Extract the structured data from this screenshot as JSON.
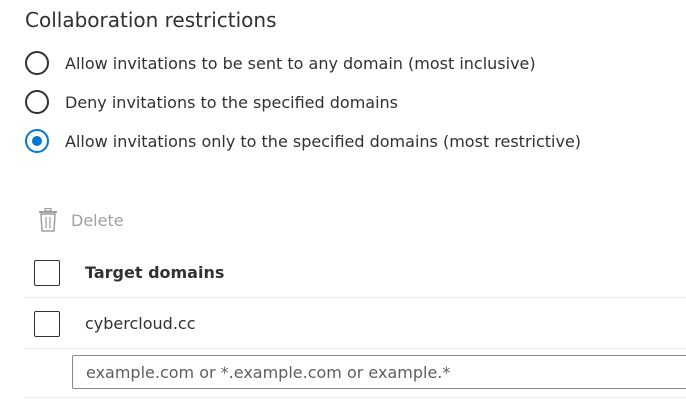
{
  "section": {
    "title": "Collaboration restrictions"
  },
  "restriction_options": [
    {
      "label": "Allow invitations to be sent to any domain (most inclusive)",
      "checked": false
    },
    {
      "label": "Deny invitations to the specified domains",
      "checked": false
    },
    {
      "label": "Allow invitations only to the specified domains (most restrictive)",
      "checked": true
    }
  ],
  "toolbar": {
    "delete_label": "Delete",
    "delete_icon": "trash-icon",
    "delete_enabled": false
  },
  "table": {
    "header": "Target domains",
    "rows": [
      {
        "domain": "cybercloud.cc",
        "selected": false
      }
    ]
  },
  "new_domain_input": {
    "value": "",
    "placeholder": "example.com or *.example.com or example.*"
  },
  "colors": {
    "accent": "#0078d4",
    "text": "#323130",
    "disabled": "#a19f9d",
    "divider": "#edebe9"
  }
}
